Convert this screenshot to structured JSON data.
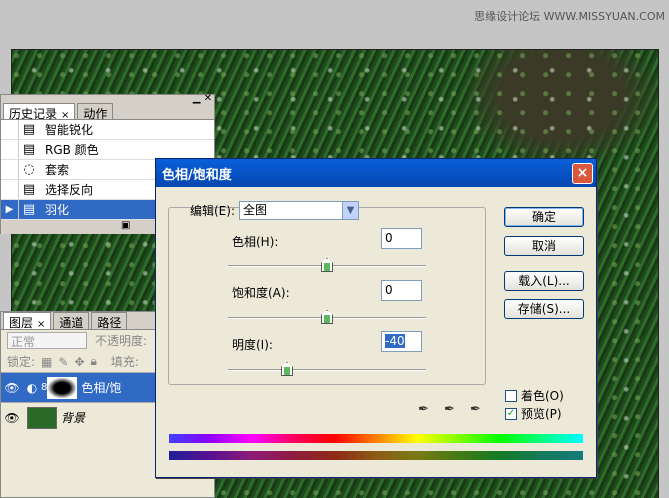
{
  "watermark": "思缘设计论坛  WWW.MISSYUAN.COM",
  "history": {
    "tabs": [
      {
        "label": "历史记录",
        "close": "×"
      },
      {
        "label": "动作"
      }
    ],
    "items": [
      {
        "label": "智能锐化"
      },
      {
        "label": "RGB 颜色"
      },
      {
        "label": "套索"
      },
      {
        "label": "选择反向"
      },
      {
        "label": "羽化"
      }
    ]
  },
  "layers": {
    "tabs": [
      {
        "label": "图层",
        "close": "×"
      },
      {
        "label": "通道"
      },
      {
        "label": "路径"
      }
    ],
    "blend_mode": "正常",
    "opacity_label": "不透明度:",
    "lock_label": "锁定:",
    "fill_label": "填充:",
    "rows": [
      {
        "name": "色相/饱"
      },
      {
        "name": "背景"
      }
    ]
  },
  "dialog": {
    "title": "色相/饱和度",
    "close": "×",
    "edit_label": "编辑(E):",
    "edit_value": "全图",
    "hue": {
      "label": "色相(H):",
      "value": "0",
      "level": 0
    },
    "saturation": {
      "label": "饱和度(A):",
      "value": "0",
      "level": 0
    },
    "lightness": {
      "label": "明度(I):",
      "value": "-40",
      "level": -40
    },
    "buttons": {
      "ok": "确定",
      "cancel": "取消",
      "load": "载入(L)...",
      "save": "存储(S)..."
    },
    "colorize": {
      "label": "着色(O)",
      "checked": false
    },
    "preview": {
      "label": "预览(P)",
      "checked": true
    }
  }
}
